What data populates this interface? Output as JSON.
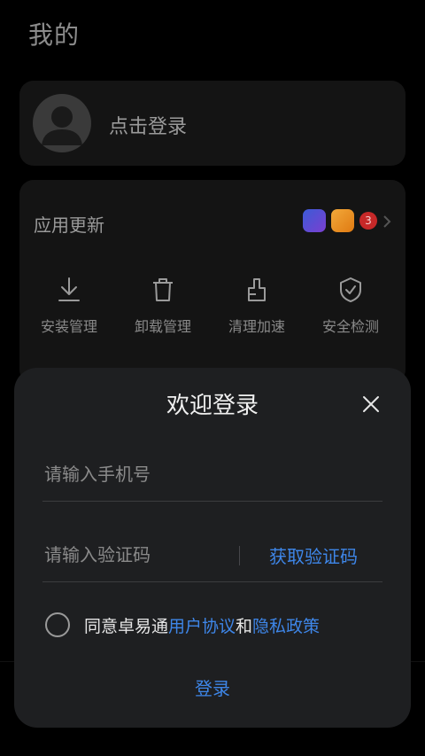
{
  "page_title": "我的",
  "profile": {
    "login_prompt": "点击登录"
  },
  "app_update": {
    "label": "应用更新",
    "badge_count": "3"
  },
  "tools": [
    {
      "label": "安装管理",
      "icon": "download-icon"
    },
    {
      "label": "卸载管理",
      "icon": "trash-icon"
    },
    {
      "label": "清理加速",
      "icon": "brush-icon"
    },
    {
      "label": "安全检测",
      "icon": "shield-check-icon"
    }
  ],
  "login_sheet": {
    "title": "欢迎登录",
    "phone_placeholder": "请输入手机号",
    "code_placeholder": "请输入验证码",
    "get_code_label": "获取验证码",
    "agree_prefix": "同意卓易通",
    "user_agreement": "用户协议",
    "and": "和",
    "privacy_policy": "隐私政策",
    "login_label": "登录"
  },
  "colors": {
    "accent": "#3e86e8",
    "badge": "#c62828",
    "sheet_bg": "#1e1f21"
  }
}
